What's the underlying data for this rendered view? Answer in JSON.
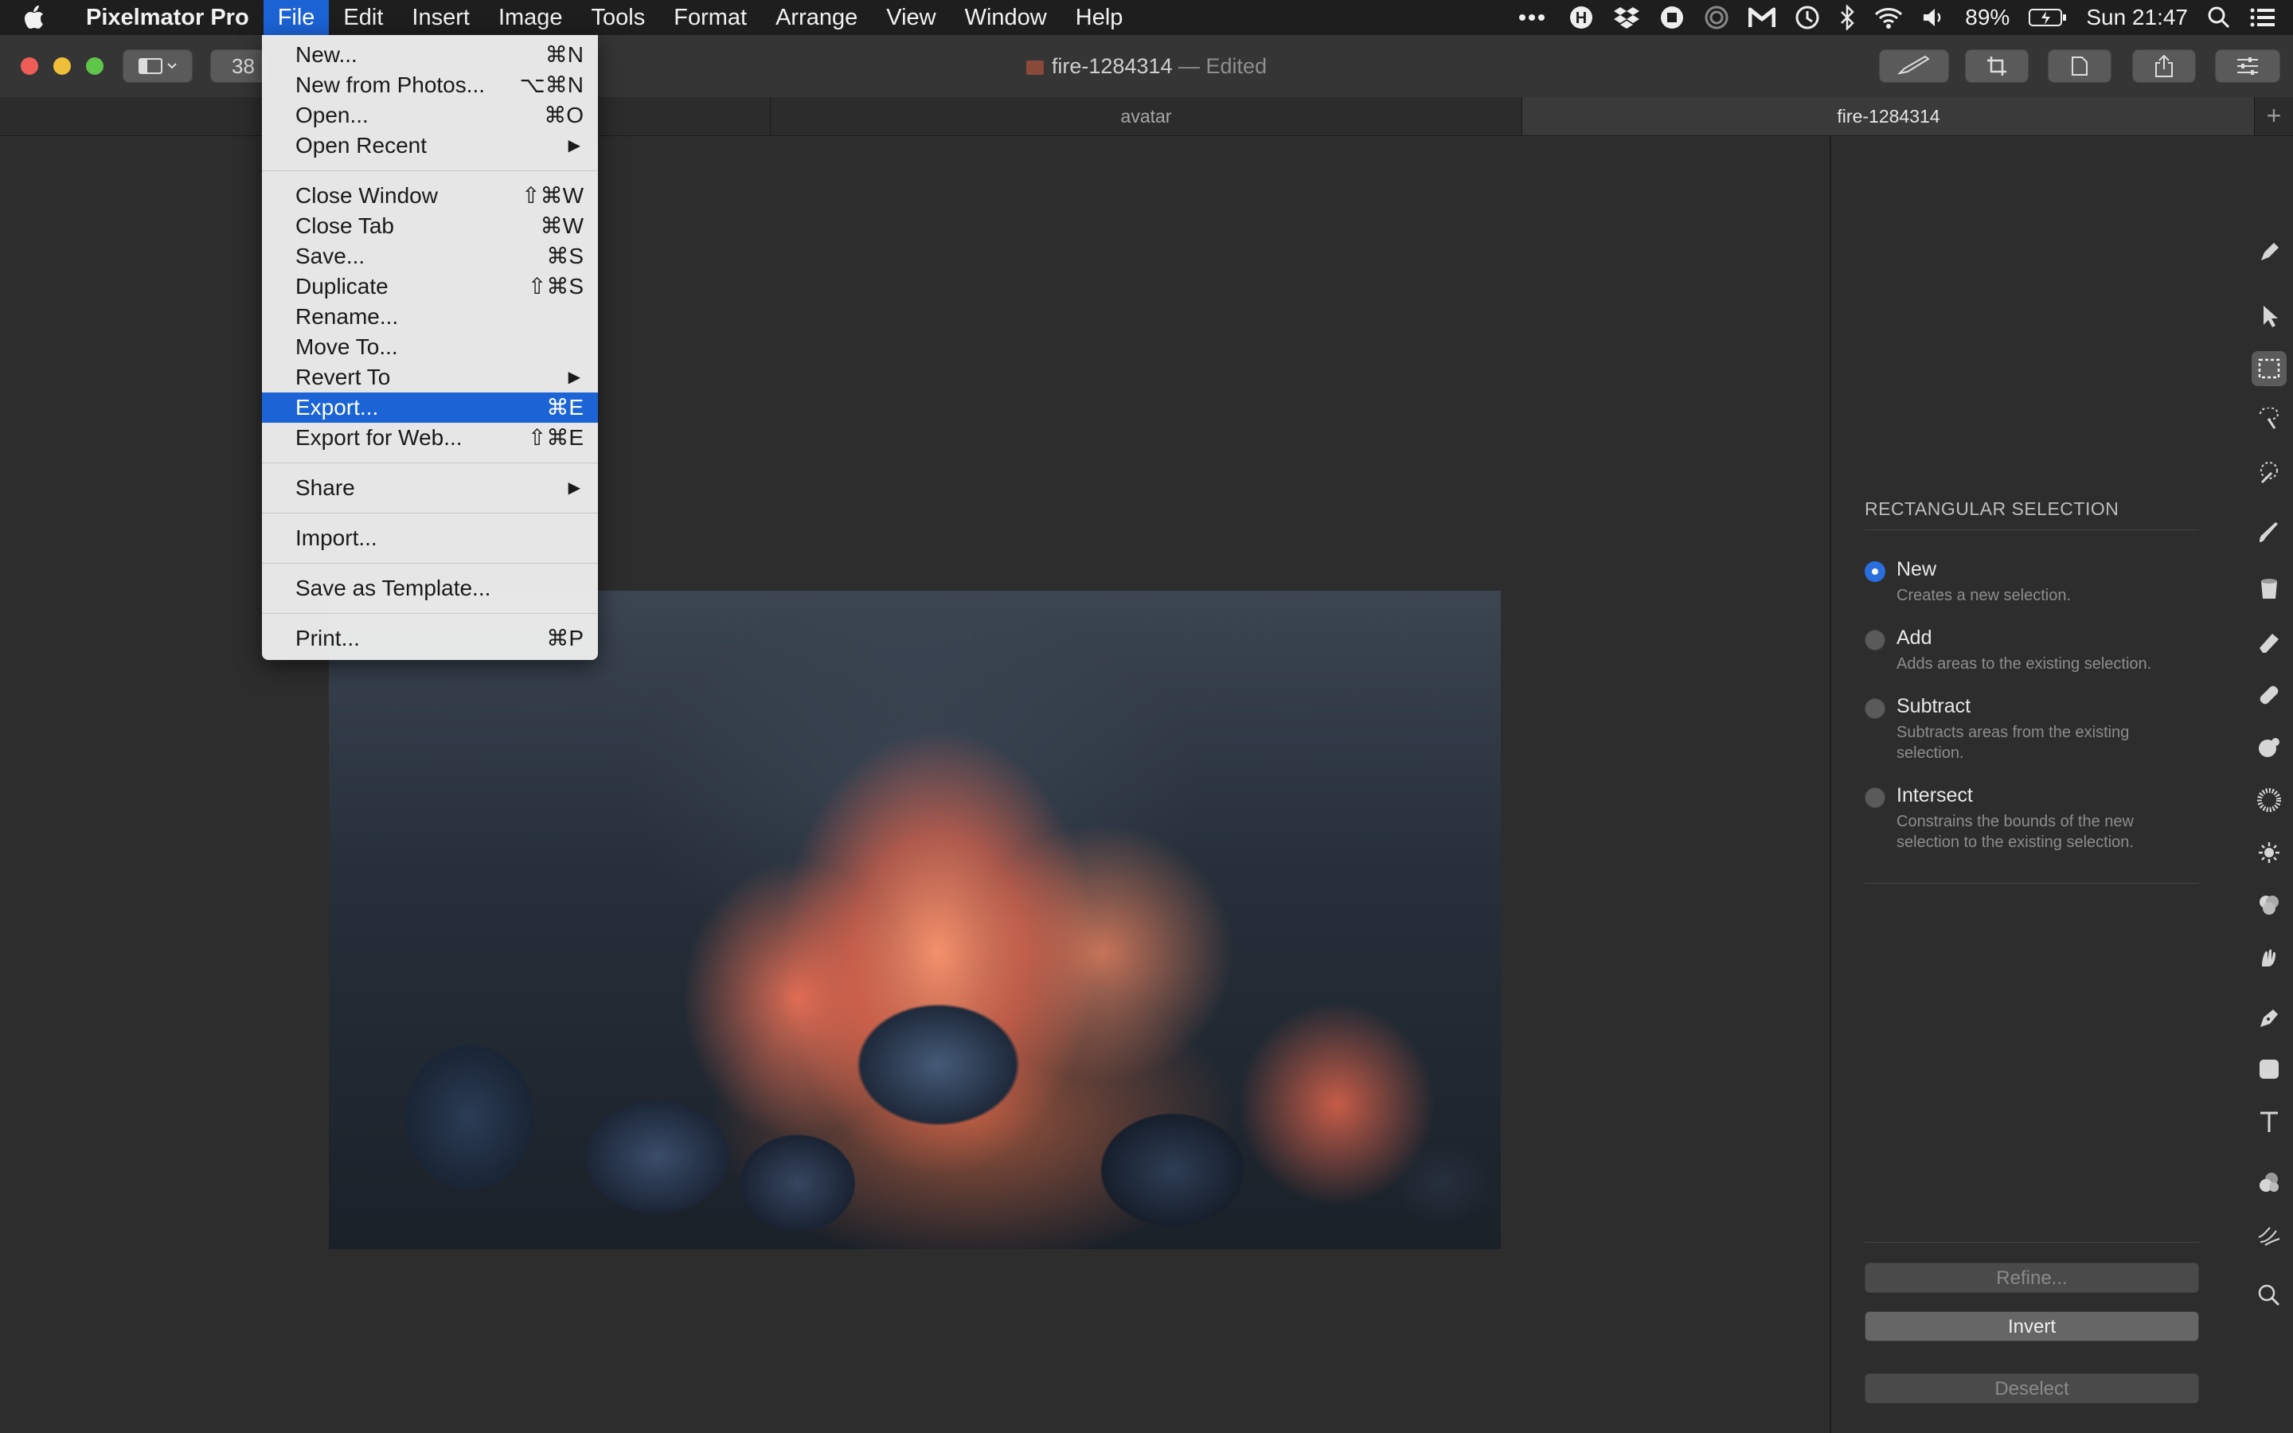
{
  "menubar": {
    "app_name": "Pixelmator Pro",
    "menus": [
      "File",
      "Edit",
      "Insert",
      "Image",
      "Tools",
      "Format",
      "Arrange",
      "View",
      "Window",
      "Help"
    ],
    "battery": "89%",
    "clock": "Sun 21:47"
  },
  "toolbar": {
    "zoom": "38",
    "document_title": "fire-1284314",
    "edited_suffix": "— Edited"
  },
  "tabs": [
    "avatar",
    "fire-1284314"
  ],
  "file_menu": {
    "items": [
      {
        "label": "New...",
        "shortcut": "⌘N"
      },
      {
        "label": "New from Photos...",
        "shortcut": "⌥⌘N"
      },
      {
        "label": "Open...",
        "shortcut": "⌘O"
      },
      {
        "label": "Open Recent",
        "submenu": "▶"
      },
      {
        "label": "Close Window",
        "shortcut": "⇧⌘W"
      },
      {
        "label": "Close Tab",
        "shortcut": "⌘W"
      },
      {
        "label": "Save...",
        "shortcut": "⌘S"
      },
      {
        "label": "Duplicate",
        "shortcut": "⇧⌘S"
      },
      {
        "label": "Rename..."
      },
      {
        "label": "Move To..."
      },
      {
        "label": "Revert To",
        "submenu": "▶"
      },
      {
        "label": "Export...",
        "shortcut": "⌘E"
      },
      {
        "label": "Export for Web...",
        "shortcut": "⇧⌘E"
      },
      {
        "label": "Share",
        "submenu": "▶"
      },
      {
        "label": "Import..."
      },
      {
        "label": "Save as Template..."
      },
      {
        "label": "Print...",
        "shortcut": "⌘P"
      }
    ]
  },
  "inspector": {
    "title": "RECTANGULAR SELECTION",
    "options": [
      {
        "label": "New",
        "desc": "Creates a new selection."
      },
      {
        "label": "Add",
        "desc": "Adds areas to the existing selection."
      },
      {
        "label": "Subtract",
        "desc": "Subtracts areas from the existing selection."
      },
      {
        "label": "Intersect",
        "desc": "Constrains the bounds of the new selection to the existing selection."
      }
    ],
    "refine_label": "Refine...",
    "invert_label": "Invert",
    "deselect_label": "Deselect"
  }
}
